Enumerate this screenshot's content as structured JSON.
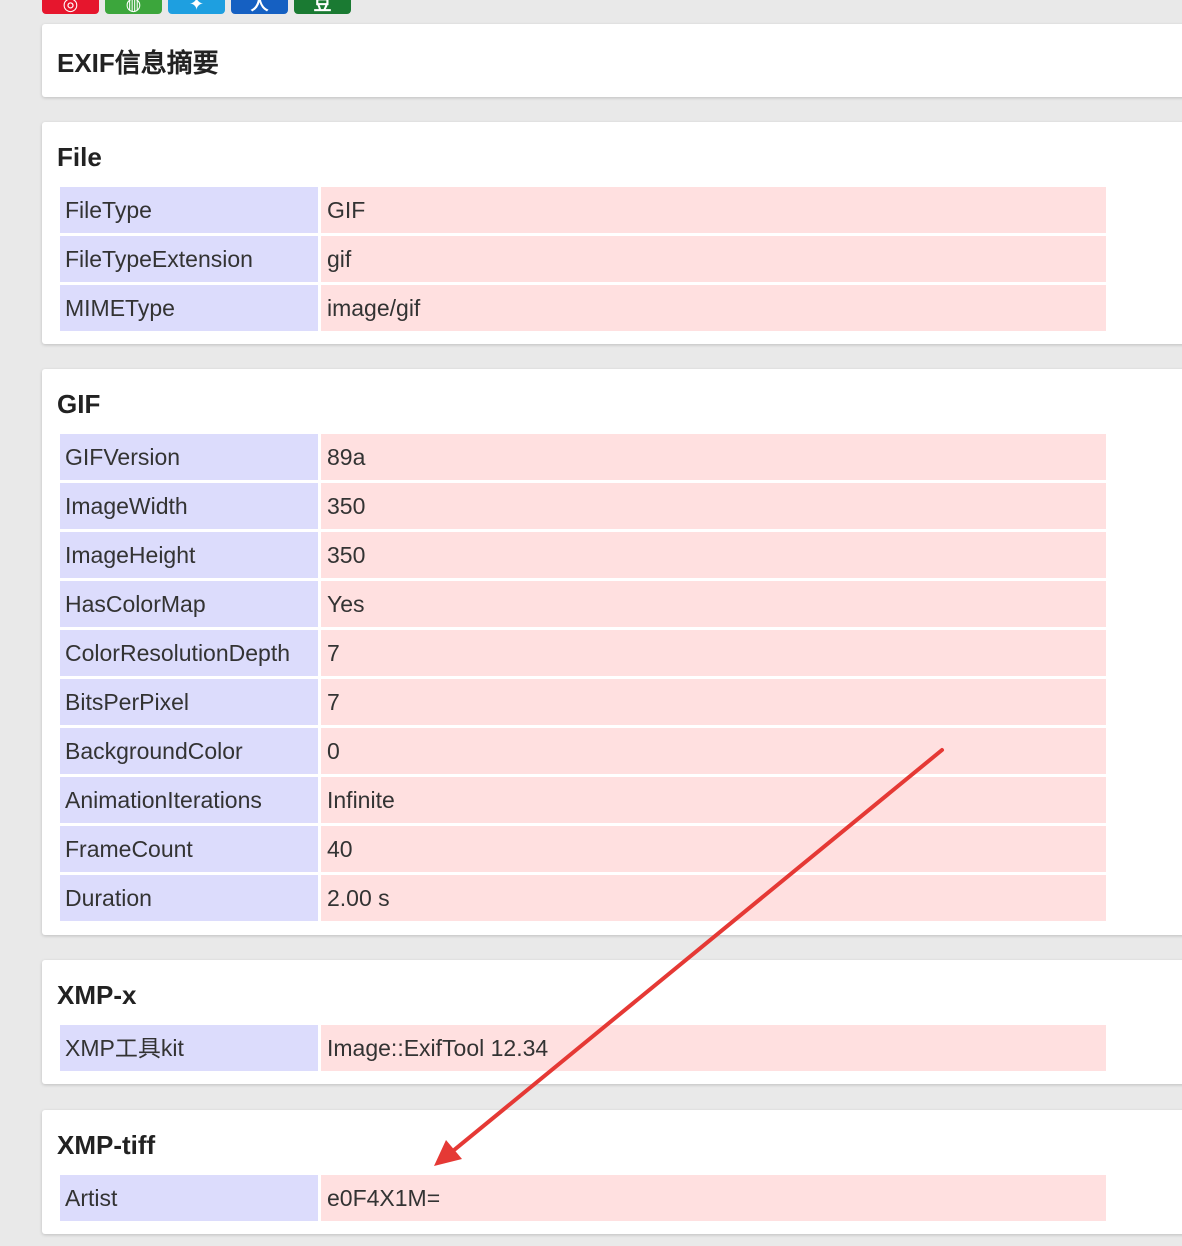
{
  "summary": {
    "title": "EXIF信息摘要"
  },
  "toolbar": {
    "icons": [
      {
        "name": "weibo-share-icon",
        "color": "#e6162d",
        "glyph": "◎"
      },
      {
        "name": "wechat-share-icon",
        "color": "#3ca63c",
        "glyph": "◍"
      },
      {
        "name": "qzone-share-icon",
        "color": "#1e9fe0",
        "glyph": "✦"
      },
      {
        "name": "renren-share-icon",
        "color": "#1560c2",
        "glyph": "人"
      },
      {
        "name": "douban-share-icon",
        "color": "#1a7a32",
        "glyph": "豆"
      }
    ]
  },
  "sections": [
    {
      "title": "File",
      "rows": [
        {
          "key": "FileType",
          "value": "GIF"
        },
        {
          "key": "FileTypeExtension",
          "value": "gif"
        },
        {
          "key": "MIMEType",
          "value": "image/gif"
        }
      ]
    },
    {
      "title": "GIF",
      "rows": [
        {
          "key": "GIFVersion",
          "value": "89a"
        },
        {
          "key": "ImageWidth",
          "value": "350"
        },
        {
          "key": "ImageHeight",
          "value": "350"
        },
        {
          "key": "HasColorMap",
          "value": "Yes"
        },
        {
          "key": "ColorResolutionDepth",
          "value": "7"
        },
        {
          "key": "BitsPerPixel",
          "value": "7"
        },
        {
          "key": "BackgroundColor",
          "value": "0"
        },
        {
          "key": "AnimationIterations",
          "value": "Infinite"
        },
        {
          "key": "FrameCount",
          "value": "40"
        },
        {
          "key": "Duration",
          "value": "2.00 s"
        }
      ]
    },
    {
      "title": "XMP-x",
      "rows": [
        {
          "key": "XMP工具kit",
          "value": "Image::ExifTool 12.34"
        }
      ]
    },
    {
      "title": "XMP-tiff",
      "rows": [
        {
          "key": "Artist",
          "value": "e0F4X1M="
        }
      ]
    }
  ],
  "colors": {
    "key_cell": "#dcdcfc",
    "value_cell": "#ffe0e0",
    "annotation_arrow": "#e53935"
  }
}
